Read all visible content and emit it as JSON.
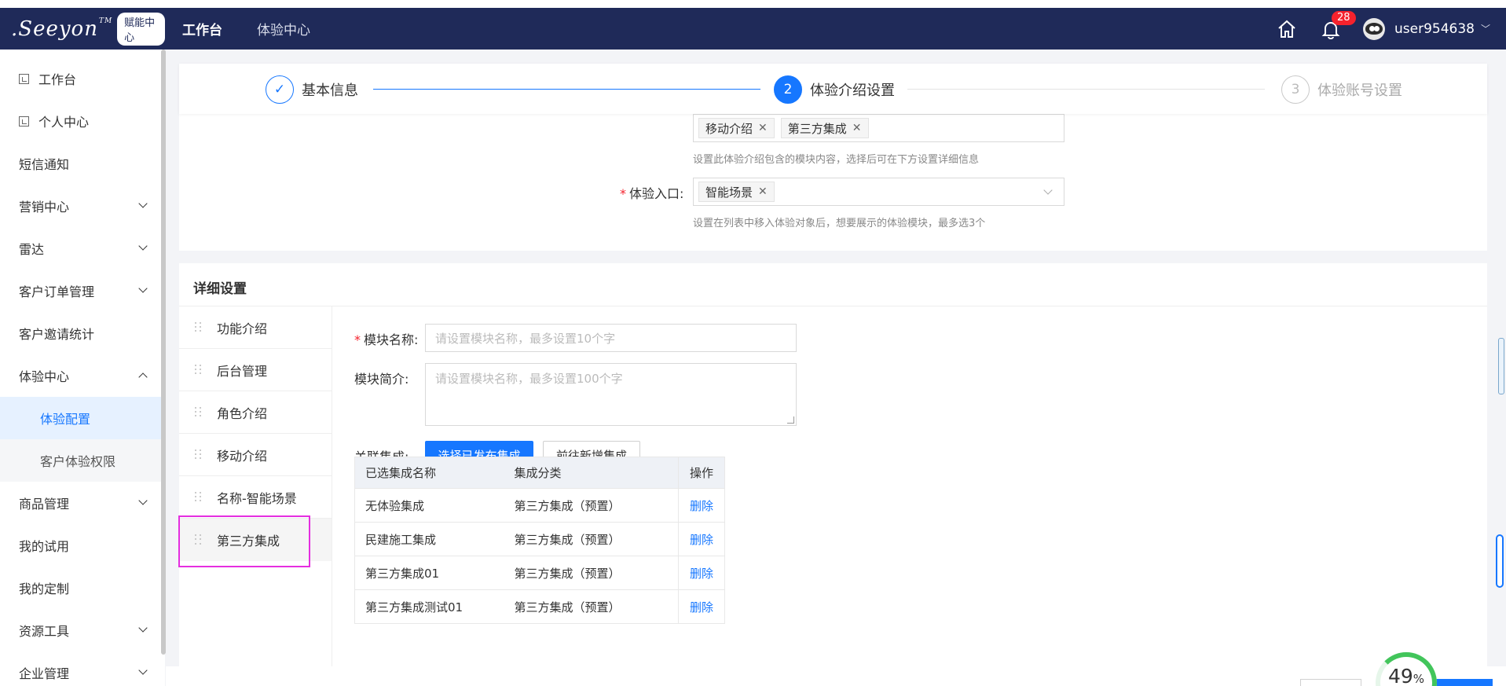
{
  "brand": {
    "logo_text": ".Seeyon",
    "tm": "TM",
    "badge": "赋能中心"
  },
  "topnav": [
    {
      "label": "工作台",
      "active": true
    },
    {
      "label": "体验中心",
      "active": false
    }
  ],
  "header": {
    "notification_count": "28",
    "username": "user954638"
  },
  "sidebar": {
    "items": [
      {
        "label": "工作台",
        "icon": "page-icon"
      },
      {
        "label": "个人中心",
        "icon": "page-icon"
      },
      {
        "label": "短信通知"
      },
      {
        "label": "营销中心",
        "expandable": true
      },
      {
        "label": "雷达",
        "expandable": true
      },
      {
        "label": "客户订单管理",
        "expandable": true
      },
      {
        "label": "客户邀请统计"
      },
      {
        "label": "体验中心",
        "expanded": true
      },
      {
        "label": "商品管理",
        "expandable": true
      },
      {
        "label": "我的试用"
      },
      {
        "label": "我的定制"
      },
      {
        "label": "资源工具",
        "expandable": true
      },
      {
        "label": "企业管理",
        "expandable": true
      }
    ],
    "sub_items": [
      {
        "label": "体验配置",
        "active": true
      },
      {
        "label": "客户体验权限",
        "active": false
      }
    ]
  },
  "steps": [
    {
      "num": "✓",
      "label": "基本信息",
      "status": "done"
    },
    {
      "num": "2",
      "label": "体验介绍设置",
      "status": "current"
    },
    {
      "num": "3",
      "label": "体验账号设置",
      "status": "pending"
    }
  ],
  "top_form": {
    "modules_tags": [
      "移动介绍",
      "第三方集成"
    ],
    "modules_hint": "设置此体验介绍包含的模块内容，选择后可在下方设置详细信息",
    "entry_label": "体验入口",
    "entry_tags": [
      "智能场景"
    ],
    "entry_hint": "设置在列表中移入体验对象后，想要展示的体验模块，最多选3个"
  },
  "detail": {
    "title": "详细设置",
    "modules": [
      "功能介绍",
      "后台管理",
      "角色介绍",
      "移动介绍",
      "名称-智能场景",
      "第三方集成"
    ],
    "active_module": 5,
    "name_label": "模块名称",
    "name_placeholder": "请设置模块名称，最多设置10个字",
    "intro_label": "模块简介",
    "intro_placeholder": "请设置模块名称，最多设置100个字",
    "link_label": "关联集成",
    "select_button": "选择已发布集成",
    "goto_button": "前往新增集成",
    "table": {
      "headers": [
        "已选集成名称",
        "集成分类",
        "操作"
      ],
      "rows": [
        {
          "name": "无体验集成",
          "category": "第三方集成（预置）",
          "action": "删除"
        },
        {
          "name": "民建施工集成",
          "category": "第三方集成（预置）",
          "action": "删除"
        },
        {
          "name": "第三方集成01",
          "category": "第三方集成（预置）",
          "action": "删除"
        },
        {
          "name": "第三方集成测试01",
          "category": "第三方集成（预置）",
          "action": "删除"
        }
      ]
    }
  },
  "progress": {
    "value": "49",
    "unit": "%"
  },
  "colors": {
    "topbar": "#1f2a59",
    "primary": "#1677ff",
    "highlight": "#e52ee0",
    "progress": "#42c55b"
  }
}
